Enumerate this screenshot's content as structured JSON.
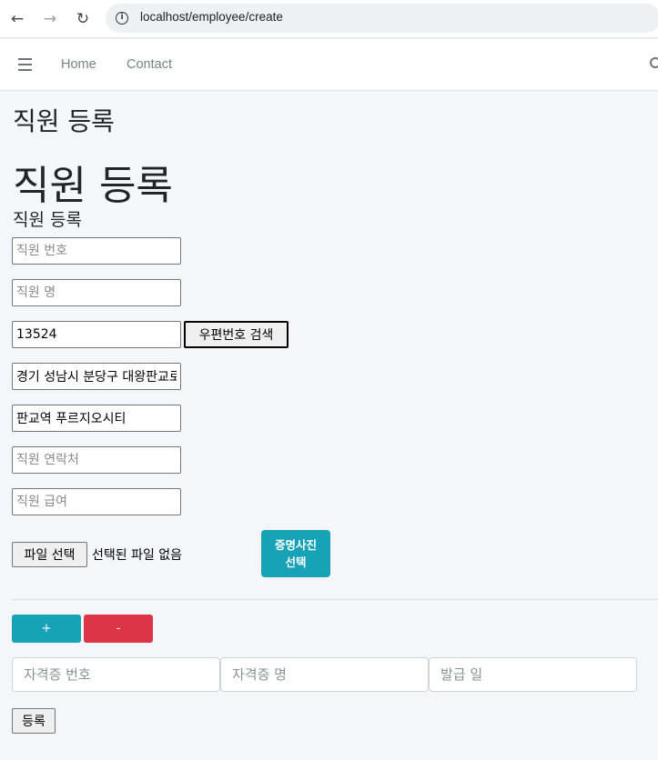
{
  "browser": {
    "back_glyph": "←",
    "forward_glyph": "→",
    "reload_glyph": "↻",
    "info_glyph": "i",
    "url": "localhost/employee/create"
  },
  "navbar": {
    "links": [
      "Home",
      "Contact"
    ]
  },
  "page": {
    "title_small": "직원 등록",
    "title_large": "직원 등록",
    "form_title": "직원 등록"
  },
  "form": {
    "employee_no": {
      "placeholder": "직원 번호",
      "value": ""
    },
    "employee_name": {
      "placeholder": "직원 명",
      "value": ""
    },
    "postcode": {
      "placeholder": "",
      "value": "13524"
    },
    "postcode_button": "우편번호 검색",
    "address": {
      "placeholder": "",
      "value": "경기 성남시 분당구 대왕판교로"
    },
    "address_detail": {
      "placeholder": "",
      "value": "판교역 푸르지오시티"
    },
    "phone": {
      "placeholder": "직원 연락처",
      "value": ""
    },
    "salary": {
      "placeholder": "직원 급여",
      "value": ""
    },
    "file_button": "파일 선택",
    "file_status": "선택된 파일 없음",
    "photo_button_line1": "증명사진",
    "photo_button_line2": "선택",
    "add_button": "+",
    "remove_button": "-",
    "cert_no": {
      "placeholder": "자격증 번호"
    },
    "cert_name": {
      "placeholder": "자격증 명"
    },
    "cert_date": {
      "placeholder": "발급 일"
    },
    "submit_button": "등록"
  },
  "colors": {
    "info_button": "#17a2b8",
    "danger_button": "#dc3545"
  }
}
